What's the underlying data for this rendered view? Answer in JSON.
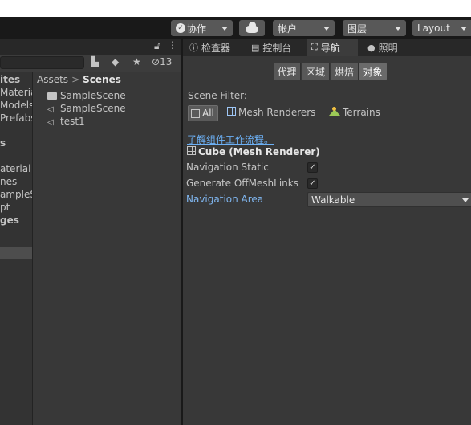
{
  "toolbar": {
    "collab_label": "协作",
    "account_label": "帐户",
    "layers_label": "图层",
    "layout_label": "Layout"
  },
  "project": {
    "hidden_count": "13",
    "tree_items": [
      "ites",
      "Materia",
      "Models",
      "Prefabs",
      "s",
      "aterial",
      "nes",
      "ampleS",
      "pt",
      "ges"
    ],
    "breadcrumb": {
      "root": "Assets",
      "current": "Scenes"
    },
    "assets": [
      {
        "label": "SampleScene",
        "icon": "folder-icon"
      },
      {
        "label": "SampleScene",
        "icon": "unity-scene-icon"
      },
      {
        "label": "test1",
        "icon": "unity-scene-icon"
      }
    ]
  },
  "tabs": [
    {
      "label": "检查器",
      "icon": "info-icon"
    },
    {
      "label": "控制台",
      "icon": "console-icon"
    },
    {
      "label": "导航",
      "icon": "navigation-icon"
    },
    {
      "label": "照明",
      "icon": "lightbulb-icon"
    }
  ],
  "nav": {
    "modes": [
      "代理",
      "区域",
      "烘焙",
      "对象"
    ],
    "scene_filter_label": "Scene Filter:",
    "filters": {
      "all": "All",
      "mesh": "Mesh Renderers",
      "terrains": "Terrains"
    },
    "learn_link": "了解组件工作流程。",
    "object_title": "Cube (Mesh Renderer)",
    "navigation_static_label": "Navigation Static",
    "navigation_static": true,
    "offmesh_label": "Generate OffMeshLinks",
    "offmesh": true,
    "area_label": "Navigation Area",
    "area_value": "Walkable"
  },
  "colors": {
    "accent_link": "#6cb0f5",
    "panel_bg": "#383838"
  }
}
